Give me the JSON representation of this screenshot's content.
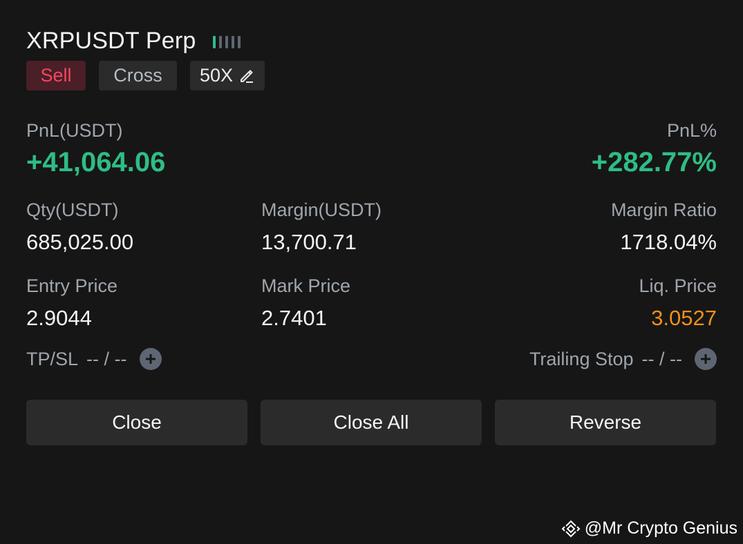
{
  "position": {
    "symbol": "XRPUSDT Perp",
    "risk_level": 1,
    "risk_bars_total": 5,
    "side": "Sell",
    "margin_mode": "Cross",
    "leverage": "50X"
  },
  "pnl": {
    "pnl_label": "PnL(USDT)",
    "pnl_value": "+41,064.06",
    "pnl_pct_label": "PnL%",
    "pnl_pct_value": "+282.77%"
  },
  "details": {
    "qty_label": "Qty(USDT)",
    "qty_value": "685,025.00",
    "margin_label": "Margin(USDT)",
    "margin_value": "13,700.71",
    "margin_ratio_label": "Margin Ratio",
    "margin_ratio_value": "1718.04%",
    "entry_label": "Entry Price",
    "entry_value": "2.9044",
    "mark_label": "Mark Price",
    "mark_value": "2.7401",
    "liq_label": "Liq. Price",
    "liq_value": "3.0527"
  },
  "orders": {
    "tpsl_label": "TP/SL",
    "tpsl_value": "-- / --",
    "trailing_label": "Trailing Stop",
    "trailing_value": "-- / --"
  },
  "actions": {
    "close_label": "Close",
    "close_all_label": "Close All",
    "reverse_label": "Reverse"
  },
  "watermark": {
    "text": "@Mr Crypto Genius"
  },
  "colors": {
    "background": "#161616",
    "profit_green": "#2ebd85",
    "sell_red": "#f6465d",
    "liq_orange": "#f0901b"
  }
}
